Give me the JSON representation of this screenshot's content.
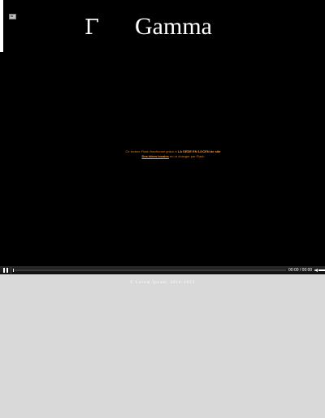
{
  "header": {
    "symbol": "Γ",
    "title": "Gamma",
    "icon": "image-icon"
  },
  "flash_notice": {
    "line1_prefix": "Ce lecteur Flash fonctionne grâce à",
    "line1_highlight": "LA SEDE EN LOCEN de site",
    "line2_link": "Des idées locales",
    "line2_suffix": "en or changer par Flash"
  },
  "player": {
    "time": "00:00 / 00:00",
    "pause_icon": "pause-icon",
    "volume_icon": "volume-icon",
    "progress": 0
  },
  "footer": {
    "copyright": "© Lorem Ipsum, 2010-2013"
  },
  "colors": {
    "stage": "#000000",
    "background": "#d9d9d9",
    "notice": "#e07a1f"
  }
}
